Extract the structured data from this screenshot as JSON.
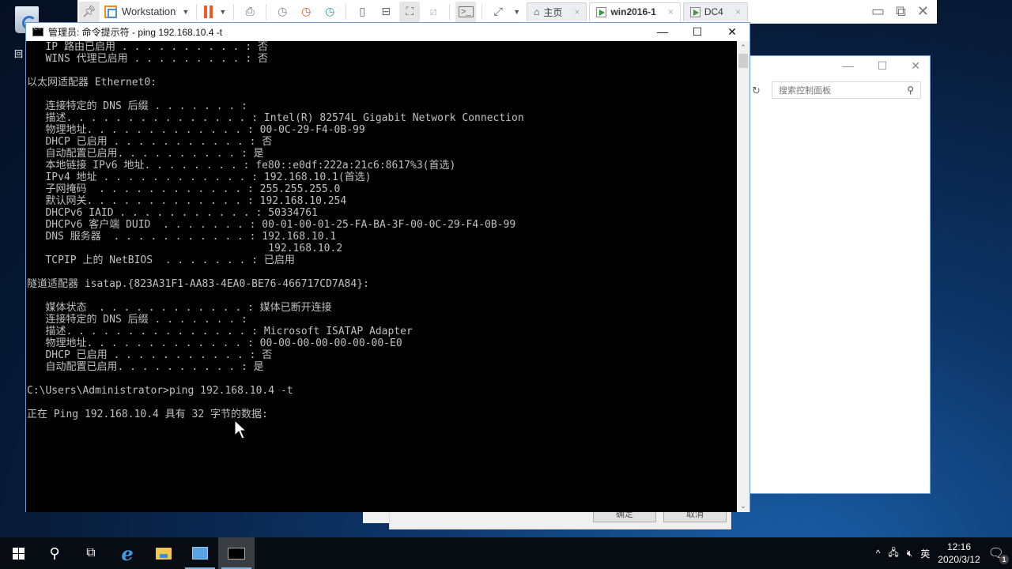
{
  "desktop": {
    "recycle_bin_label": "回"
  },
  "vmware": {
    "product_label": "Workstation",
    "tabs": [
      {
        "label": "主页",
        "icon": "home-icon",
        "active": false
      },
      {
        "label": "win2016-1",
        "icon": "vm-icon",
        "active": true
      },
      {
        "label": "DC4",
        "icon": "vm-icon",
        "active": false
      }
    ],
    "tab_close": "×"
  },
  "control_panel": {
    "search_placeholder": "搜索控制面板"
  },
  "dialog": {
    "ok_label": "确定",
    "cancel_label": "取消"
  },
  "cmd": {
    "title": "管理员: 命令提示符 - ping  192.168.10.4 -t",
    "lines": [
      "   IP 路由已启用 . . . . . . . . . . : 否",
      "   WINS 代理已启用 . . . . . . . . . : 否",
      "",
      "以太网适配器 Ethernet0:",
      "",
      "   连接特定的 DNS 后缀 . . . . . . . :",
      "   描述. . . . . . . . . . . . . . . : Intel(R) 82574L Gigabit Network Connection",
      "   物理地址. . . . . . . . . . . . . : 00-0C-29-F4-0B-99",
      "   DHCP 已启用 . . . . . . . . . . . : 否",
      "   自动配置已启用. . . . . . . . . . : 是",
      "   本地链接 IPv6 地址. . . . . . . . : fe80::e0df:222a:21c6:8617%3(首选)",
      "   IPv4 地址 . . . . . . . . . . . . : 192.168.10.1(首选)",
      "   子网掩码  . . . . . . . . . . . . : 255.255.255.0",
      "   默认网关. . . . . . . . . . . . . : 192.168.10.254",
      "   DHCPv6 IAID . . . . . . . . . . . : 50334761",
      "   DHCPv6 客户端 DUID  . . . . . . . : 00-01-00-01-25-FA-BA-3F-00-0C-29-F4-0B-99",
      "   DNS 服务器  . . . . . . . . . . . : 192.168.10.1",
      "                                       192.168.10.2",
      "   TCPIP 上的 NetBIOS  . . . . . . . : 已启用",
      "",
      "隧道适配器 isatap.{823A31F1-AA83-4EA0-BE76-466717CD7A84}:",
      "",
      "   媒体状态  . . . . . . . . . . . . : 媒体已断开连接",
      "   连接特定的 DNS 后缀 . . . . . . . :",
      "   描述. . . . . . . . . . . . . . . : Microsoft ISATAP Adapter",
      "   物理地址. . . . . . . . . . . . . : 00-00-00-00-00-00-00-E0",
      "   DHCP 已启用 . . . . . . . . . . . : 否",
      "   自动配置已启用. . . . . . . . . . : 是",
      "",
      "C:\\Users\\Administrator>ping 192.168.10.4 -t",
      "",
      "正在 Ping 192.168.10.4 具有 32 字节的数据:"
    ]
  },
  "taskbar": {
    "ime_label": "英",
    "time": "12:16",
    "date": "2020/3/12",
    "notification_count": "1"
  }
}
